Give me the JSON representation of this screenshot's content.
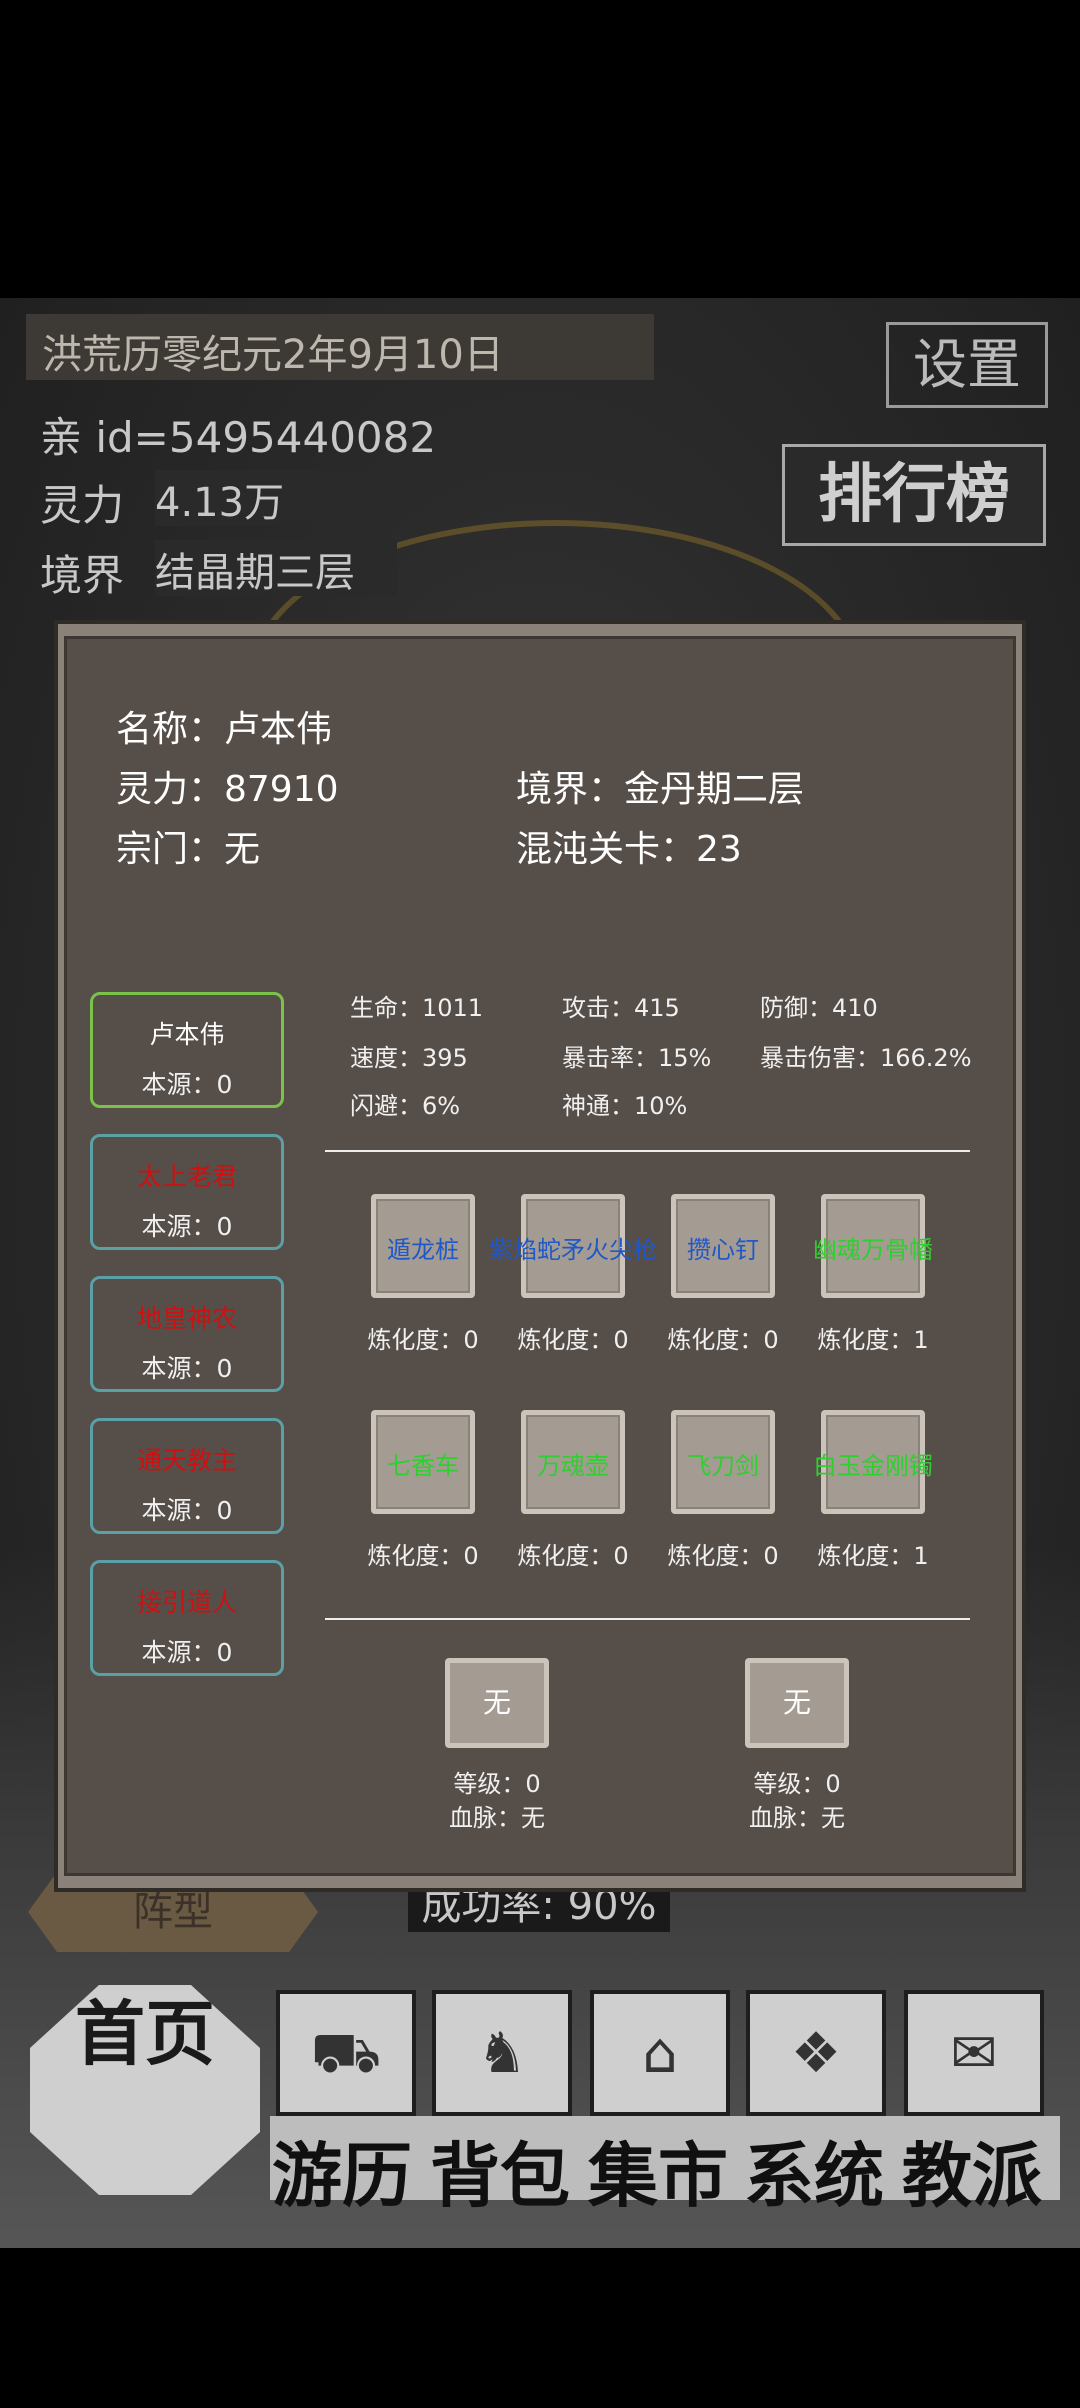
{
  "background": {
    "date": "洪荒历零纪元2年9月10日",
    "settings_label": "设置",
    "rank_label": "排行榜",
    "id_line": "亲 id=5495440082",
    "spirit_label": "灵力",
    "spirit_value": "4.13万",
    "realm_label": "境界",
    "realm_value": "结晶期三层",
    "formation_label": "阵型",
    "success_rate": "成功率: 90%"
  },
  "nav": {
    "home": "首页",
    "items": [
      "游历",
      "背包",
      "集市",
      "系统",
      "教派"
    ]
  },
  "profile": {
    "name_line": "名称：卢本伟",
    "spirit_line": "灵力：87910",
    "realm_line": "境界：金丹期二层",
    "sect_line": "宗门：无",
    "chaos_line": "混沌关卡：23"
  },
  "characters": [
    {
      "name": "卢本伟",
      "base": "本源：0",
      "color": "#ffffff"
    },
    {
      "name": "太上老君",
      "base": "本源：0",
      "color": "#d01010"
    },
    {
      "name": "地皇神农",
      "base": "本源：0",
      "color": "#d01010"
    },
    {
      "name": "通天教主",
      "base": "本源：0",
      "color": "#d01010"
    },
    {
      "name": "接引道人",
      "base": "本源：0",
      "color": "#d01010"
    }
  ],
  "stats": {
    "hp": "生命：1011",
    "atk": "攻击：415",
    "def": "防御：410",
    "speed": "速度：395",
    "crit": "暴击率：15%",
    "crit_dmg": "暴击伤害：166.2%",
    "dodge": "闪避：6%",
    "divine": "神通：10%"
  },
  "items_row1": [
    {
      "name": "遁龙桩",
      "refine": "炼化度：0",
      "color": "blue"
    },
    {
      "name": "紫焰蛇矛火尖枪",
      "refine": "炼化度：0",
      "color": "blue"
    },
    {
      "name": "攒心钉",
      "refine": "炼化度：0",
      "color": "blue"
    },
    {
      "name": "幽魂万骨幡",
      "refine": "炼化度：1",
      "color": "green"
    }
  ],
  "items_row2": [
    {
      "name": "七香车",
      "refine": "炼化度：0",
      "color": "green"
    },
    {
      "name": "万魂壶",
      "refine": "炼化度：0",
      "color": "green"
    },
    {
      "name": "飞刀剑",
      "refine": "炼化度：0",
      "color": "green"
    },
    {
      "name": "白玉金刚镯",
      "refine": "炼化度：1",
      "color": "green"
    }
  ],
  "beasts": [
    {
      "slot": "无",
      "level": "等级：0",
      "blood": "血脉：无"
    },
    {
      "slot": "无",
      "level": "等级：0",
      "blood": "血脉：无"
    }
  ]
}
